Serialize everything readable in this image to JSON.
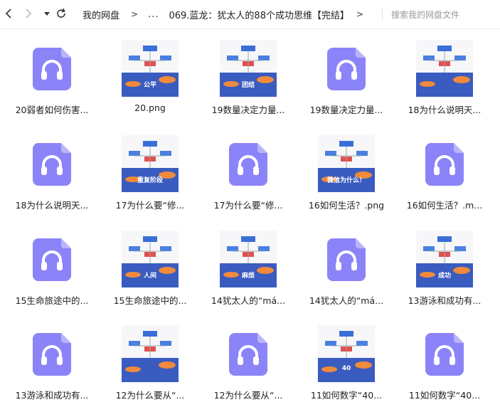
{
  "colors": {
    "audio_icon": "#8b84f8",
    "accent": "#3a5bbf"
  },
  "nav": {
    "back_icon": "chevron-left-icon",
    "forward_icon": "chevron-right-icon",
    "history_icon": "caret-down-icon",
    "refresh_icon": "refresh-icon"
  },
  "breadcrumb": {
    "root": "我的网盘",
    "sep": ">",
    "ellipsis": "...",
    "current": "069.蓝龙：犹太人的88个成功思维【完结】",
    "trailing_sep": ">"
  },
  "search": {
    "placeholder": "搜索我的网盘文件"
  },
  "files": [
    {
      "name": "20弱者如何伤害...",
      "type": "audio"
    },
    {
      "name": "20.png",
      "type": "image",
      "caption": "公平"
    },
    {
      "name": "19数量决定力量...",
      "type": "image",
      "caption": "团结"
    },
    {
      "name": "19数量决定力量...",
      "type": "audio"
    },
    {
      "name": "18为什么说明天...",
      "type": "image",
      "caption": ""
    },
    {
      "name": "18为什么说明天...",
      "type": "audio"
    },
    {
      "name": "17为什么要“修...",
      "type": "image",
      "caption": "重复阶段"
    },
    {
      "name": "17为什么要“修...",
      "type": "audio"
    },
    {
      "name": "16如何生活？.png",
      "type": "image",
      "caption": "微信为什么！"
    },
    {
      "name": "16如何生活？.m...",
      "type": "audio"
    },
    {
      "name": "15生命旅途中的...",
      "type": "audio"
    },
    {
      "name": "15生命旅途中的...",
      "type": "image",
      "caption": "人间"
    },
    {
      "name": "14犹太人的“má...",
      "type": "image",
      "caption": "麻烦"
    },
    {
      "name": "14犹太人的“má...",
      "type": "audio"
    },
    {
      "name": "13游泳和成功有...",
      "type": "image",
      "caption": "成功"
    },
    {
      "name": "13游泳和成功有...",
      "type": "audio"
    },
    {
      "name": "12为什么要从“...",
      "type": "image",
      "caption": ""
    },
    {
      "name": "12为什么要从“...",
      "type": "audio"
    },
    {
      "name": "11如何数字“40...",
      "type": "image",
      "caption": "40"
    },
    {
      "name": "11如何数字“40...",
      "type": "audio"
    }
  ]
}
